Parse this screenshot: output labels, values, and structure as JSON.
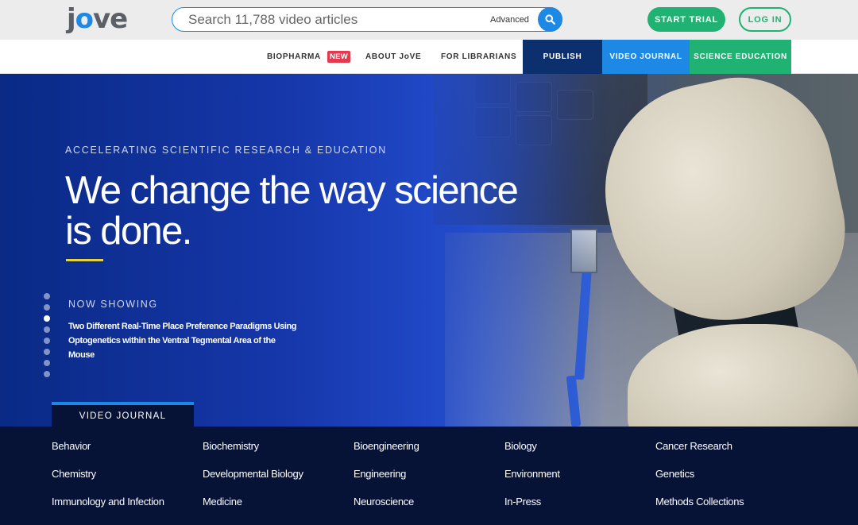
{
  "header": {
    "logo_text_pre": "j",
    "logo_text_o": "o",
    "logo_text_post": "ve",
    "search_placeholder": "Search 11,788 video articles",
    "advanced_label": "Advanced",
    "search_icon": "search-icon",
    "start_trial_label": "START TRIAL",
    "login_label": "LOG IN"
  },
  "nav": {
    "biopharma": "BIOPHARMA",
    "new_badge": "NEW",
    "about": "ABOUT JoVE",
    "librarians": "FOR LIBRARIANS",
    "publish": "PUBLISH",
    "video_journal": "VIDEO JOURNAL",
    "science_education": "SCIENCE EDUCATION"
  },
  "hero": {
    "kicker": "ACCELERATING SCIENTIFIC RESEARCH & EDUCATION",
    "headline_line1": "We change the way science",
    "headline_line2": "is done.",
    "now_showing_label": "NOW SHOWING",
    "now_showing_title": "Two Different Real-Time Place Preference Paradigms Using Optogenetics within the Ventral Tegmental Area of the Mouse",
    "slide_count": 8,
    "active_slide": 3,
    "tab_label": "VIDEO JOURNAL"
  },
  "categories": [
    [
      "Behavior",
      "Biochemistry",
      "Bioengineering",
      "Biology",
      "Cancer Research"
    ],
    [
      "Chemistry",
      "Developmental Biology",
      "Engineering",
      "Environment",
      "Genetics"
    ],
    [
      "Immunology and Infection",
      "Medicine",
      "Neuroscience",
      "In-Press",
      "Methods Collections"
    ]
  ],
  "colors": {
    "brand_blue": "#1e88e5",
    "brand_green": "#1fb273",
    "navy": "#061236",
    "publish": "#0c2f6e",
    "new_badge": "#e53950",
    "accent_yellow": "#e5d33a"
  }
}
